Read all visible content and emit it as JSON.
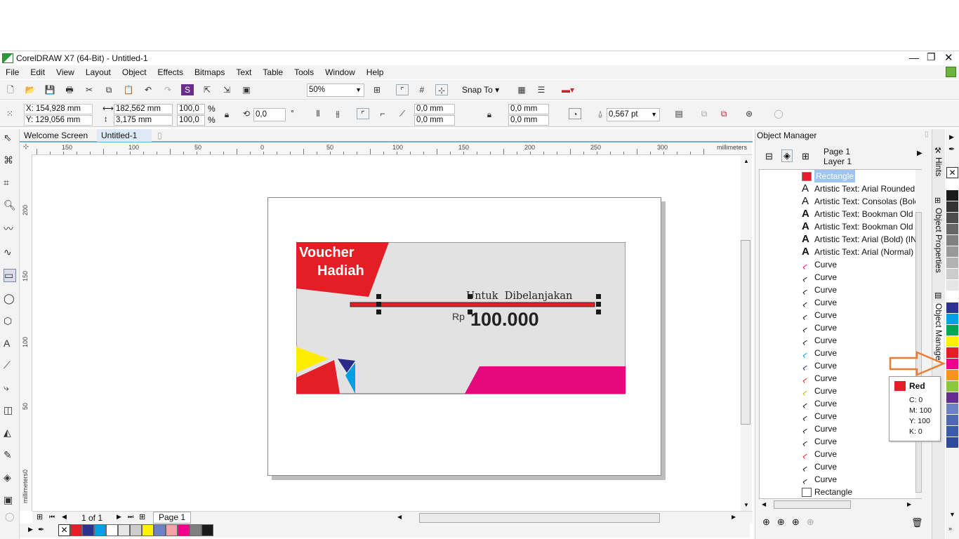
{
  "title": "CorelDRAW X7 (64-Bit) - Untitled-1",
  "menu": [
    "File",
    "Edit",
    "View",
    "Layout",
    "Object",
    "Effects",
    "Bitmaps",
    "Text",
    "Table",
    "Tools",
    "Window",
    "Help"
  ],
  "toolbar": {
    "zoom": "50%",
    "snap": "Snap To"
  },
  "props": {
    "x": "X: 154,928 mm",
    "y": "Y: 129,056 mm",
    "w": "182,562 mm",
    "h": "3,175 mm",
    "sx": "100,0",
    "sy": "100,0",
    "pct": "%",
    "angle": "0,0",
    "deg": "°",
    "c1": "0,0 mm",
    "c2": "0,0 mm",
    "c3": "0,0 mm",
    "c4": "0,0 mm",
    "outline": "0,567 pt"
  },
  "tabs": [
    "Welcome Screen",
    "Untitled-1"
  ],
  "ruler": {
    "unit": "millimeters",
    "top": [
      "150",
      "100",
      "50",
      "0",
      "50",
      "100",
      "150",
      "200",
      "250",
      "300"
    ],
    "left": [
      "200",
      "150",
      "100",
      "50",
      "0"
    ],
    "left_unit": "millimeters"
  },
  "voucher": {
    "title1": "Voucher",
    "title2": "Hadiah",
    "subtitle": "Untuk  Dibelanjakan",
    "currency": "Rp",
    "amount": "100.000"
  },
  "status": {
    "pages": "1 of 1",
    "page_tab": "Page 1"
  },
  "colors": {
    "red": "#e31e26",
    "magenta": "#e4097d",
    "yellow": "#ffed00",
    "blue": "#009fe3",
    "navy": "#2b2a86",
    "grey": "#e2e2e2",
    "accent": "#ee7d31"
  },
  "object_manager": {
    "header": "Object Manager",
    "page": "Page 1",
    "layer": "Layer 1",
    "items": [
      {
        "label": "Rectangle",
        "icon": "rectangle-red",
        "selected": true
      },
      {
        "label": "Artistic Text: Arial Rounded",
        "icon": "text-outline"
      },
      {
        "label": "Artistic Text: Consolas (Bolc",
        "icon": "text-outline"
      },
      {
        "label": "Artistic Text: Bookman Old",
        "icon": "text-solid"
      },
      {
        "label": "Artistic Text: Bookman Old",
        "icon": "text-solid"
      },
      {
        "label": "Artistic Text: Arial (Bold) (IN",
        "icon": "text-solid"
      },
      {
        "label": "Artistic Text: Arial (Normal)",
        "icon": "text-solid"
      },
      {
        "label": "Curve",
        "icon": "curve-magenta"
      },
      {
        "label": "Curve",
        "icon": "curve-black"
      },
      {
        "label": "Curve",
        "icon": "curve-black"
      },
      {
        "label": "Curve",
        "icon": "curve-black"
      },
      {
        "label": "Curve",
        "icon": "curve-black"
      },
      {
        "label": "Curve",
        "icon": "curve-black"
      },
      {
        "label": "Curve",
        "icon": "curve-black"
      },
      {
        "label": "Curve",
        "icon": "curve-blue"
      },
      {
        "label": "Curve",
        "icon": "curve-navy"
      },
      {
        "label": "Curve",
        "icon": "curve-red"
      },
      {
        "label": "Curve",
        "icon": "curve-yellow"
      },
      {
        "label": "Curve",
        "icon": "curve-black"
      },
      {
        "label": "Curve",
        "icon": "curve-black"
      },
      {
        "label": "Curve",
        "icon": "curve-black"
      },
      {
        "label": "Curve",
        "icon": "curve-black"
      },
      {
        "label": "Curve",
        "icon": "curve-red"
      },
      {
        "label": "Curve",
        "icon": "curve-black"
      },
      {
        "label": "Curve",
        "icon": "curve-black"
      },
      {
        "label": "Rectangle",
        "icon": "rectangle-white"
      }
    ]
  },
  "side_tabs": [
    "Hints",
    "Object Properties",
    "Object Manager"
  ],
  "tooltip": {
    "name": "Red",
    "c": "C: 0",
    "m": "M: 100",
    "y": "Y: 100",
    "k": "K: 0"
  },
  "right_palette": [
    "#ffffff",
    "#1a1a1a",
    "#333333",
    "#4d4d4d",
    "#666666",
    "#808080",
    "#999999",
    "#b3b3b3",
    "#cccccc",
    "#e6e6e6",
    "#ffffff",
    "#2e3192",
    "#00a0e3",
    "#00a651",
    "#fff200",
    "#e31e26",
    "#ec008c",
    "#f7941d",
    "#8dc63f",
    "#662d91",
    "#6d82c2",
    "#4f69b3",
    "#3b5aa7",
    "#2e4c9a"
  ],
  "bottom_palette": [
    "#e31e26",
    "#2e3192",
    "#00a0e3",
    "#ffffff",
    "#e6e6e6",
    "#cccccc",
    "#fff200",
    "#6d82c2",
    "#f4a3a8",
    "#ec008c",
    "#808080",
    "#1a1a1a"
  ]
}
